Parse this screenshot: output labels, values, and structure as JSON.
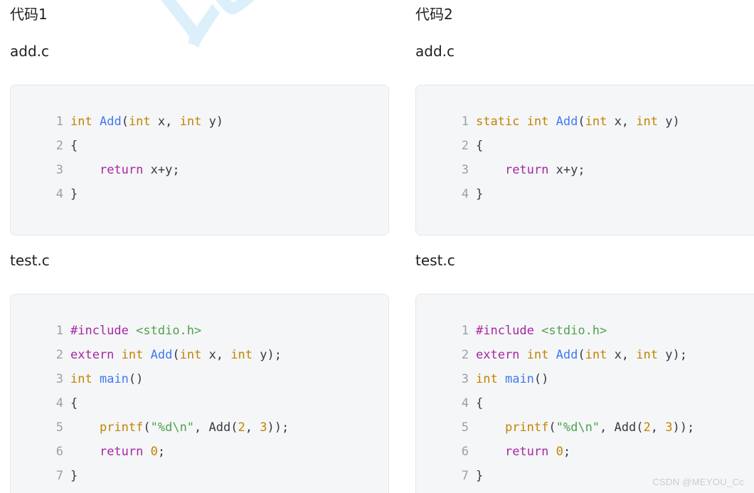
{
  "watermark": {
    "diagonal_text": "比特",
    "diagonal_color": "#d6eefb",
    "footer_text": "CSDN @MEYOU_Cc",
    "footer_color": "#c9ccd1"
  },
  "theme": {
    "code_background": "#f5f6f7",
    "code_border": "#e4e6e8",
    "line_number_color": "#9aa0a6",
    "keyword_color": "#a626a4",
    "type_color": "#c18401",
    "function_color": "#4078f2",
    "string_color": "#50a14f",
    "plain_color": "#383a42",
    "page_background": "#ffffff",
    "text_color": "#1f1f1f"
  },
  "columns": [
    {
      "title": "代码1",
      "add_file_label": "add.c",
      "test_file_label": "test.c",
      "add_code": {
        "language": "c",
        "lines": [
          {
            "n": "1",
            "tokens": [
              {
                "t": "int",
                "c": "t-type"
              },
              {
                "t": " ",
                "c": "t-pl"
              },
              {
                "t": "Add",
                "c": "t-fn"
              },
              {
                "t": "(",
                "c": "t-pl"
              },
              {
                "t": "int",
                "c": "t-type"
              },
              {
                "t": " x, ",
                "c": "t-pl"
              },
              {
                "t": "int",
                "c": "t-type"
              },
              {
                "t": " y)",
                "c": "t-pl"
              }
            ]
          },
          {
            "n": "2",
            "tokens": [
              {
                "t": "{",
                "c": "t-pl"
              }
            ]
          },
          {
            "n": "3",
            "tokens": [
              {
                "t": "    ",
                "c": "t-pl"
              },
              {
                "t": "return",
                "c": "t-kw"
              },
              {
                "t": " x+y;",
                "c": "t-pl"
              }
            ]
          },
          {
            "n": "4",
            "tokens": [
              {
                "t": "}",
                "c": "t-pl"
              }
            ]
          }
        ]
      },
      "test_code": {
        "language": "c",
        "lines": [
          {
            "n": "1",
            "tokens": [
              {
                "t": "#include",
                "c": "t-kw"
              },
              {
                "t": " ",
                "c": "t-pl"
              },
              {
                "t": "<stdio.h>",
                "c": "t-str"
              }
            ]
          },
          {
            "n": "2",
            "tokens": [
              {
                "t": "extern",
                "c": "t-kw"
              },
              {
                "t": " ",
                "c": "t-pl"
              },
              {
                "t": "int",
                "c": "t-type"
              },
              {
                "t": " ",
                "c": "t-pl"
              },
              {
                "t": "Add",
                "c": "t-fn"
              },
              {
                "t": "(",
                "c": "t-pl"
              },
              {
                "t": "int",
                "c": "t-type"
              },
              {
                "t": " x, ",
                "c": "t-pl"
              },
              {
                "t": "int",
                "c": "t-type"
              },
              {
                "t": " y);",
                "c": "t-pl"
              }
            ]
          },
          {
            "n": "3",
            "tokens": [
              {
                "t": "int",
                "c": "t-type"
              },
              {
                "t": " ",
                "c": "t-pl"
              },
              {
                "t": "main",
                "c": "t-fn"
              },
              {
                "t": "()",
                "c": "t-pl"
              }
            ]
          },
          {
            "n": "4",
            "tokens": [
              {
                "t": "{",
                "c": "t-pl"
              }
            ]
          },
          {
            "n": "5",
            "tokens": [
              {
                "t": "    ",
                "c": "t-pl"
              },
              {
                "t": "printf",
                "c": "t-type"
              },
              {
                "t": "(",
                "c": "t-pl"
              },
              {
                "t": "\"%d\\n\"",
                "c": "t-str"
              },
              {
                "t": ", ",
                "c": "t-pl"
              },
              {
                "t": "Add",
                "c": "t-pl"
              },
              {
                "t": "(",
                "c": "t-pl"
              },
              {
                "t": "2",
                "c": "t-num"
              },
              {
                "t": ", ",
                "c": "t-pl"
              },
              {
                "t": "3",
                "c": "t-num"
              },
              {
                "t": "));",
                "c": "t-pl"
              }
            ]
          },
          {
            "n": "6",
            "tokens": [
              {
                "t": "    ",
                "c": "t-pl"
              },
              {
                "t": "return",
                "c": "t-kw"
              },
              {
                "t": " ",
                "c": "t-pl"
              },
              {
                "t": "0",
                "c": "t-num"
              },
              {
                "t": ";",
                "c": "t-pl"
              }
            ]
          },
          {
            "n": "7",
            "tokens": [
              {
                "t": "}",
                "c": "t-pl"
              }
            ]
          }
        ]
      }
    },
    {
      "title": "代码2",
      "add_file_label": "add.c",
      "test_file_label": "test.c",
      "add_code": {
        "language": "c",
        "lines": [
          {
            "n": "1",
            "tokens": [
              {
                "t": "static",
                "c": "t-type"
              },
              {
                "t": " ",
                "c": "t-pl"
              },
              {
                "t": "int",
                "c": "t-type"
              },
              {
                "t": " ",
                "c": "t-pl"
              },
              {
                "t": "Add",
                "c": "t-fn"
              },
              {
                "t": "(",
                "c": "t-pl"
              },
              {
                "t": "int",
                "c": "t-type"
              },
              {
                "t": " x, ",
                "c": "t-pl"
              },
              {
                "t": "int",
                "c": "t-type"
              },
              {
                "t": " y)",
                "c": "t-pl"
              }
            ]
          },
          {
            "n": "2",
            "tokens": [
              {
                "t": "{",
                "c": "t-pl"
              }
            ]
          },
          {
            "n": "3",
            "tokens": [
              {
                "t": "    ",
                "c": "t-pl"
              },
              {
                "t": "return",
                "c": "t-kw"
              },
              {
                "t": " x+y;",
                "c": "t-pl"
              }
            ]
          },
          {
            "n": "4",
            "tokens": [
              {
                "t": "}",
                "c": "t-pl"
              }
            ]
          }
        ]
      },
      "test_code": {
        "language": "c",
        "lines": [
          {
            "n": "1",
            "tokens": [
              {
                "t": "#include",
                "c": "t-kw"
              },
              {
                "t": " ",
                "c": "t-pl"
              },
              {
                "t": "<stdio.h>",
                "c": "t-str"
              }
            ]
          },
          {
            "n": "2",
            "tokens": [
              {
                "t": "extern",
                "c": "t-kw"
              },
              {
                "t": " ",
                "c": "t-pl"
              },
              {
                "t": "int",
                "c": "t-type"
              },
              {
                "t": " ",
                "c": "t-pl"
              },
              {
                "t": "Add",
                "c": "t-fn"
              },
              {
                "t": "(",
                "c": "t-pl"
              },
              {
                "t": "int",
                "c": "t-type"
              },
              {
                "t": " x, ",
                "c": "t-pl"
              },
              {
                "t": "int",
                "c": "t-type"
              },
              {
                "t": " y);",
                "c": "t-pl"
              }
            ]
          },
          {
            "n": "3",
            "tokens": [
              {
                "t": "int",
                "c": "t-type"
              },
              {
                "t": " ",
                "c": "t-pl"
              },
              {
                "t": "main",
                "c": "t-fn"
              },
              {
                "t": "()",
                "c": "t-pl"
              }
            ]
          },
          {
            "n": "4",
            "tokens": [
              {
                "t": "{",
                "c": "t-pl"
              }
            ]
          },
          {
            "n": "5",
            "tokens": [
              {
                "t": "    ",
                "c": "t-pl"
              },
              {
                "t": "printf",
                "c": "t-type"
              },
              {
                "t": "(",
                "c": "t-pl"
              },
              {
                "t": "\"%d\\n\"",
                "c": "t-str"
              },
              {
                "t": ", ",
                "c": "t-pl"
              },
              {
                "t": "Add",
                "c": "t-pl"
              },
              {
                "t": "(",
                "c": "t-pl"
              },
              {
                "t": "2",
                "c": "t-num"
              },
              {
                "t": ", ",
                "c": "t-pl"
              },
              {
                "t": "3",
                "c": "t-num"
              },
              {
                "t": "));",
                "c": "t-pl"
              }
            ]
          },
          {
            "n": "6",
            "tokens": [
              {
                "t": "    ",
                "c": "t-pl"
              },
              {
                "t": "return",
                "c": "t-kw"
              },
              {
                "t": " ",
                "c": "t-pl"
              },
              {
                "t": "0",
                "c": "t-num"
              },
              {
                "t": ";",
                "c": "t-pl"
              }
            ]
          },
          {
            "n": "7",
            "tokens": [
              {
                "t": "}",
                "c": "t-pl"
              }
            ]
          }
        ]
      }
    }
  ]
}
